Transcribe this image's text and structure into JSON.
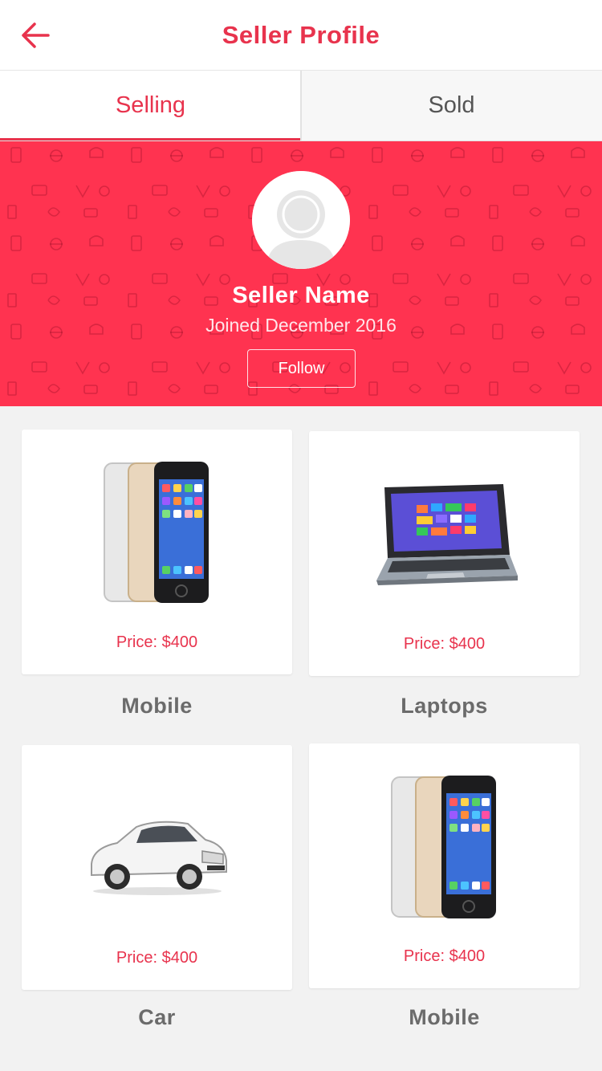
{
  "colors": {
    "accent": "#ff3350",
    "accent_text": "#e8334d",
    "muted_text": "#6b6b6b",
    "background": "#f2f2f2"
  },
  "header": {
    "title": "Seller Profile",
    "back_icon": "arrow-left-icon"
  },
  "tabs": [
    {
      "label": "Selling",
      "active": true
    },
    {
      "label": "Sold",
      "active": false
    }
  ],
  "seller": {
    "name": "Seller Name",
    "joined": "Joined December 2016",
    "follow_label": "Follow",
    "avatar_icon": "user-avatar-icon"
  },
  "products": [
    {
      "price": "Price: $400",
      "category": "Mobile",
      "image_icon": "smartphone-icon"
    },
    {
      "price": "Price: $400",
      "category": "Laptops",
      "image_icon": "laptop-icon"
    },
    {
      "price": "Price: $400",
      "category": "Car",
      "image_icon": "car-icon"
    },
    {
      "price": "Price: $400",
      "category": "Mobile",
      "image_icon": "smartphone-icon"
    }
  ]
}
